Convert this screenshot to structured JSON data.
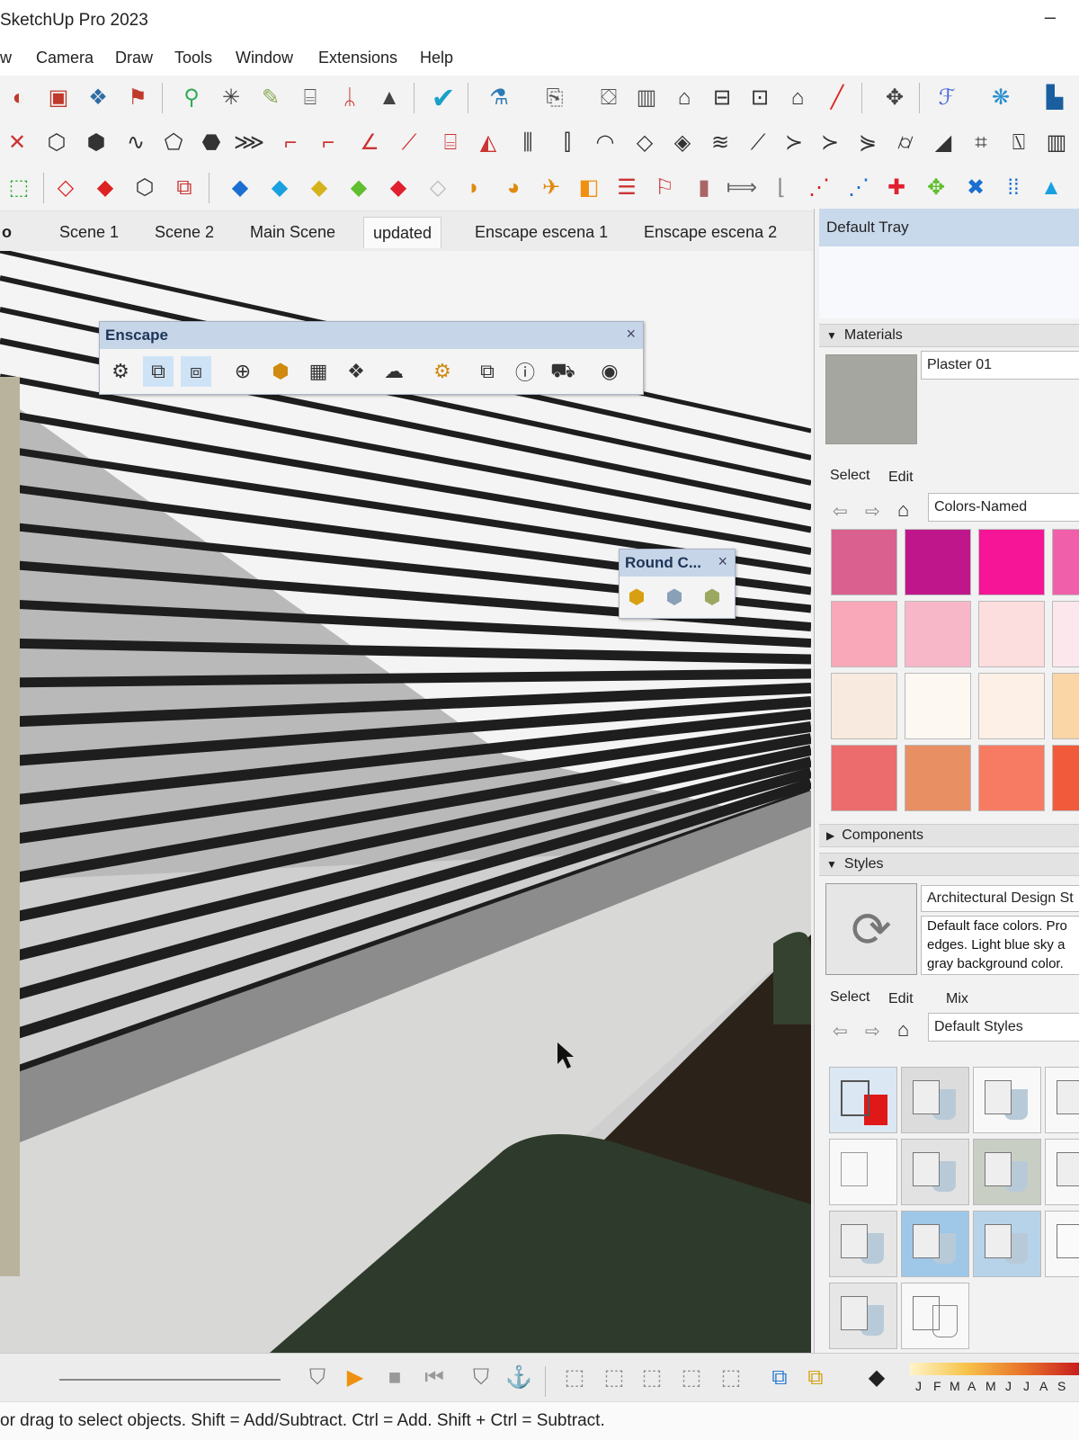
{
  "app": {
    "title": "SketchUp Pro 2023",
    "minimize_glyph": "–"
  },
  "menu": [
    "w",
    "Camera",
    "Draw",
    "Tools",
    "Window",
    "Extensions",
    "Help"
  ],
  "toolbars": {
    "row1_icons": [
      "styles-icon",
      "component-icon",
      "materials-icon",
      "paint-icon",
      "follow-icon",
      "axes-icon",
      "tape-icon",
      "dimension-icon",
      "text-icon",
      "protractor-icon",
      "check-icon",
      "flask-icon",
      "scene-icon",
      "camera-icon",
      "iso-icon",
      "front-icon",
      "top-icon",
      "back-icon",
      "side-icon",
      "pencil-icon",
      "orbit-icon",
      "extension-icon",
      "warehouse-icon",
      "layout-icon"
    ],
    "row2_icons": [
      "intersect-icon",
      "solid-icon",
      "outer-shell-icon",
      "trim-icon",
      "split-icon",
      "box-icon",
      "sandbox-icon",
      "from-contours-icon",
      "line-icon",
      "arc-icon",
      "freehand-icon",
      "smoove-icon",
      "stamp-icon",
      "drape-icon",
      "grid-icon",
      "add-detail-icon",
      "flip-edge-icon",
      "push-pull-icon",
      "offset-icon",
      "rotate-icon",
      "scale-icon",
      "follow-me-icon",
      "move-icon",
      "section-icon",
      "section-fill-icon",
      "walk-icon",
      "look-icon"
    ],
    "row3_icons": [
      "3d-text-icon",
      "eraser-icon",
      "select-icon",
      "cube-icon",
      "make-group-icon",
      "paint-blue-icon",
      "paint-cyan-icon",
      "paint-yellow-icon",
      "paint-green-icon",
      "paint-red-icon",
      "hide-icon",
      "arc-tool-icon",
      "pie-icon",
      "rotated-rect-icon",
      "circle-icon",
      "polygon-icon",
      "rect-icon",
      "freehand-tool-icon",
      "tag-icon",
      "axes-tool-icon",
      "protractor-tool-icon",
      "points-icon",
      "polyline-icon",
      "move-red-icon",
      "move-green-icon",
      "rotate-blue-icon",
      "grid-tool-icon",
      "cone-icon"
    ]
  },
  "scene_tabs": [
    "Scene 1",
    "Scene 2",
    "Main Scene",
    "updated",
    "Enscape escena 1",
    "Enscape escena 2"
  ],
  "active_scene_tab": "updated",
  "scene_tab_left_glyph": "o",
  "enscape_toolbar": {
    "title": "Enscape",
    "close": "×",
    "icons": [
      "start-enscape-icon",
      "sync-updates-icon",
      "sync-views-icon",
      "capture-icon",
      "asset-library-icon",
      "material-editor-icon",
      "render-settings-icon",
      "upload-icon",
      "settings-icon",
      "window-icon",
      "about-icon",
      "cart-icon",
      "account-icon"
    ]
  },
  "round_corner_toolbar": {
    "title": "Round C...",
    "close": "×",
    "icons": [
      "round-corner-icon",
      "sharp-corner-icon",
      "bevel-icon"
    ]
  },
  "tray": {
    "title": "Default Tray",
    "materials": {
      "section_label": "Materials",
      "current_material": "Plaster 01",
      "tabs": [
        "Select",
        "Edit"
      ],
      "library": "Colors-Named",
      "swatches": [
        "#d9608f",
        "#c0168c",
        "#f51596",
        "#f060aa",
        "#f8a8b8",
        "#f8b7c8",
        "#fbdedd",
        "#fce8ec",
        "#f8eadf",
        "#fdf8f2",
        "#fdf0e6",
        "#fad5a5",
        "#ec6b6d",
        "#e88f64",
        "#f77b63",
        "#f25a3c"
      ],
      "material_color": "#a6a6a0"
    },
    "components": {
      "section_label": "Components"
    },
    "styles": {
      "section_label": "Styles",
      "style_name": "Architectural Design St",
      "description": [
        "Default face colors. Pro",
        "edges. Light blue sky a",
        "gray background color."
      ],
      "tabs": [
        "Select",
        "Edit",
        "Mix"
      ],
      "library": "Default Styles"
    }
  },
  "bottom": {
    "months": [
      "J",
      "F",
      "M",
      "A",
      "M",
      "J",
      "J",
      "A",
      "S"
    ],
    "animation_icons": [
      "scene-add-icon",
      "play-icon",
      "stop-icon",
      "prev-icon",
      "scene-icon",
      "anchor-icon"
    ],
    "view_icons": [
      "view1-icon",
      "view2-icon",
      "view3-icon",
      "view4-icon",
      "view5-icon",
      "view6-icon",
      "view7-icon"
    ],
    "misc_icons": [
      "shadow-icon",
      "eraser-small-icon"
    ]
  },
  "status": {
    "text": "or drag to select objects. Shift = Add/Subtract. Ctrl = Add. Shift + Ctrl = Subtract."
  }
}
